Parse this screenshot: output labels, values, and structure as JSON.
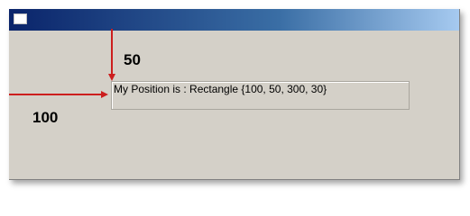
{
  "window": {
    "title": ""
  },
  "label": {
    "text": "My Position is : Rectangle {100, 50, 300, 30}"
  },
  "annotations": {
    "top_offset": "50",
    "left_offset": "100",
    "arrow_color": "#cc1e1e"
  },
  "icons": {
    "title_icon": "window-icon"
  }
}
